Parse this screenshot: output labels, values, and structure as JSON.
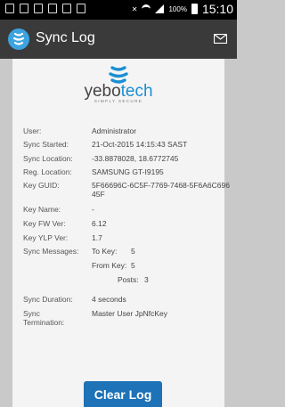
{
  "status_bar": {
    "battery_percent": "100%",
    "time": "15:10"
  },
  "action_bar": {
    "title": "Sync Log"
  },
  "logo": {
    "word_part1": "yebo",
    "word_part2": "tech",
    "tagline": "SIMPLY SECURE"
  },
  "log": {
    "user_label": "User:",
    "user_value": "Administrator",
    "sync_started_label": "Sync Started:",
    "sync_started_value": "21-Oct-2015 14:15:43 SAST",
    "sync_location_label": "Sync Location:",
    "sync_location_value": "-33.8878028, 18.6772745",
    "reg_location_label": "Reg. Location:",
    "reg_location_value": "SAMSUNG GT-I9195",
    "key_guid_label": "Key GUID:",
    "key_guid_value": "5F66696C-6C5F-7769-7468-5F6A6C69645F",
    "key_name_label": "Key Name:",
    "key_name_value": "-",
    "key_fw_label": "Key FW Ver:",
    "key_fw_value": "6.12",
    "key_ylp_label": "Key YLP Ver:",
    "key_ylp_value": "1.7",
    "sync_messages_label": "Sync Messages:",
    "to_key_label": "To Key:",
    "to_key_value": "5",
    "from_key_label": "From Key:",
    "from_key_value": "5",
    "posts_label": "Posts:",
    "posts_value": "3",
    "sync_duration_label": "Sync Duration:",
    "sync_duration_value": "4 seconds",
    "sync_termination_label": "Sync Termination:",
    "sync_termination_value": "Master User JpNfcKey"
  },
  "buttons": {
    "clear_log": "Clear Log"
  },
  "colors": {
    "action_bar": "#3a3a3a",
    "accent": "#1d72b8",
    "logo_blue": "#1b8fd2"
  }
}
